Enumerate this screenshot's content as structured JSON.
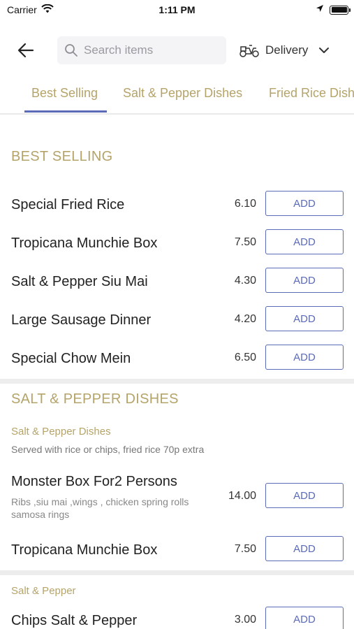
{
  "status_bar": {
    "carrier": "Carrier",
    "time": "1:11 PM",
    "battery_level": 1.0
  },
  "header": {
    "back_icon": "arrow-left-icon",
    "search_placeholder": "Search items",
    "search_value": "",
    "delivery_label": "Delivery",
    "delivery_icon": "scooter-icon",
    "chevron_icon": "chevron-down-icon"
  },
  "tabs": [
    {
      "label": "Best Selling",
      "active": true
    },
    {
      "label": "Salt & Pepper Dishes",
      "active": false
    },
    {
      "label": "Fried Rice Dishes",
      "active": false
    }
  ],
  "best_selling": {
    "title": "BEST SELLING",
    "items": [
      {
        "name": "Special Fried Rice",
        "price": "6.10",
        "add_label": "ADD"
      },
      {
        "name": "Tropicana Munchie Box",
        "price": "7.50",
        "add_label": "ADD"
      },
      {
        "name": "Salt & Pepper Siu Mai",
        "price": "4.30",
        "add_label": "ADD"
      },
      {
        "name": "Large Sausage Dinner",
        "price": "4.20",
        "add_label": "ADD"
      },
      {
        "name": "Special Chow Mein",
        "price": "6.50",
        "add_label": "ADD"
      }
    ]
  },
  "salt_pepper": {
    "title": "SALT & PEPPER DISHES",
    "subsection": "Salt & Pepper Dishes",
    "subsection_desc": "Served with rice or chips, fried rice 70p extra",
    "items": [
      {
        "name": "Monster Box For2 Persons",
        "desc": "Ribs ,siu mai ,wings , chicken spring rolls samosa rings",
        "price": "14.00",
        "add_label": "ADD"
      },
      {
        "name": "Tropicana Munchie Box",
        "price": "7.50",
        "add_label": "ADD"
      }
    ],
    "subsection2": "Salt & Pepper",
    "items2": [
      {
        "name": "Chips Salt & Pepper",
        "price": "3.00",
        "add_label": "ADD"
      }
    ]
  },
  "colors": {
    "accent": "#5b6bb8",
    "gold": "#b5a46a"
  }
}
